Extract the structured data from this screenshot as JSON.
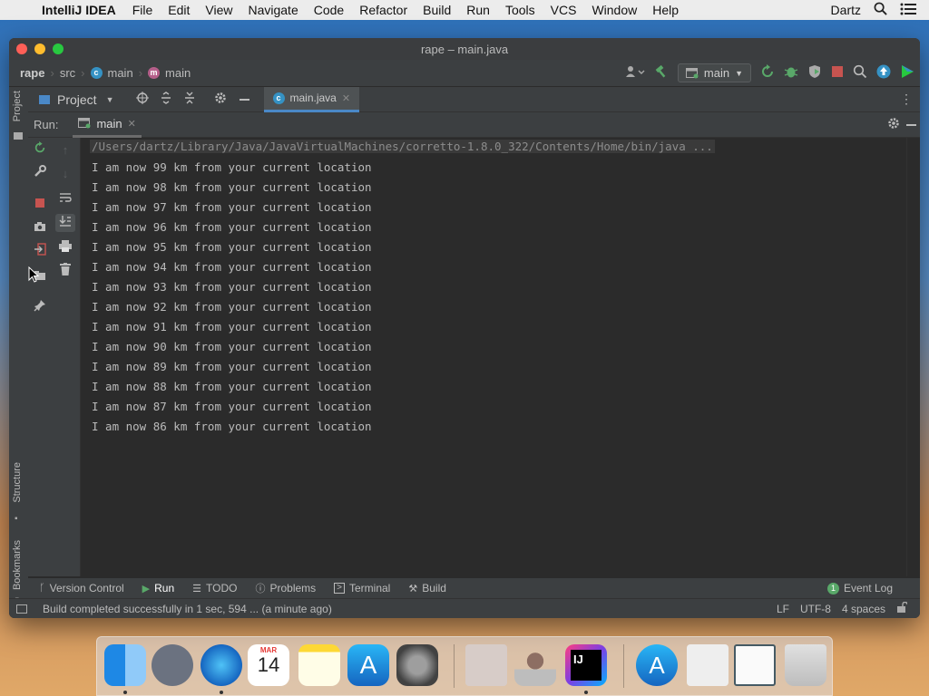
{
  "menubar": {
    "app_name": "IntelliJ IDEA",
    "items": [
      "File",
      "Edit",
      "View",
      "Navigate",
      "Code",
      "Refactor",
      "Build",
      "Run",
      "Tools",
      "VCS",
      "Window",
      "Help"
    ],
    "user": "Dartz"
  },
  "window": {
    "title": "rape – main.java"
  },
  "breadcrumb": {
    "project": "rape",
    "folder": "src",
    "class": "main",
    "method": "main"
  },
  "navbar": {
    "run_config": "main"
  },
  "toolbar": {
    "project_label": "Project",
    "editor_tab": "main.java"
  },
  "run_panel": {
    "label": "Run:",
    "tab": "main"
  },
  "side_labels": {
    "project": "Project",
    "structure": "Structure",
    "bookmarks": "Bookmarks"
  },
  "console": {
    "command": "/Users/dartz/Library/Java/JavaVirtualMachines/corretto-1.8.0_322/Contents/Home/bin/java ...",
    "lines": [
      "I am now 99 km from your current location",
      "I am now 98 km from your current location",
      "I am now 97 km from your current location",
      "I am now 96 km from your current location",
      "I am now 95 km from your current location",
      "I am now 94 km from your current location",
      "I am now 93 km from your current location",
      "I am now 92 km from your current location",
      "I am now 91 km from your current location",
      "I am now 90 km from your current location",
      "I am now 89 km from your current location",
      "I am now 88 km from your current location",
      "I am now 87 km from your current location",
      "I am now 86 km from your current location"
    ]
  },
  "bottom_tools": {
    "version_control": "Version Control",
    "run": "Run",
    "todo": "TODO",
    "problems": "Problems",
    "terminal": "Terminal",
    "build": "Build",
    "event_log_count": "1",
    "event_log": "Event Log"
  },
  "status": {
    "message": "Build completed successfully in 1 sec, 594 ... (a minute ago)",
    "line_sep": "LF",
    "encoding": "UTF-8",
    "indent": "4 spaces"
  },
  "dock": {
    "calendar_month": "MAR",
    "calendar_day": "14",
    "ij_label": "IJ"
  },
  "colors": {
    "accent": "#4a88c7",
    "run_green": "#59a869",
    "stop_red": "#c75450",
    "java_class": "#3592c4",
    "method_pink": "#b55f8a"
  }
}
